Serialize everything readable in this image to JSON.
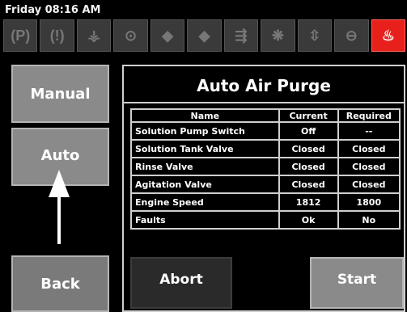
{
  "header": {
    "clock": "Friday 08:16 AM"
  },
  "icon_bar": {
    "icons": [
      {
        "name": "parking-brake-icon",
        "glyph": "(P)",
        "active": false
      },
      {
        "name": "warning-icon",
        "glyph": "(!)",
        "active": false
      },
      {
        "name": "sprayer-valve-icon",
        "glyph": "⚶",
        "active": false
      },
      {
        "name": "engine-icon",
        "glyph": "⊙",
        "active": false
      },
      {
        "name": "pump-icon",
        "glyph": "◆",
        "active": false
      },
      {
        "name": "pump-flow-icon",
        "glyph": "◆",
        "active": false
      },
      {
        "name": "valve-icon",
        "glyph": "⇶",
        "active": false
      },
      {
        "name": "agitation-icon",
        "glyph": "❋",
        "active": false
      },
      {
        "name": "tank-icon",
        "glyph": "⇳",
        "active": false
      },
      {
        "name": "fill-icon",
        "glyph": "⊖",
        "active": false
      },
      {
        "name": "alarm-icon",
        "glyph": "♨",
        "active": true
      }
    ],
    "alert_color": "#e8201c"
  },
  "side": {
    "manual_label": "Manual",
    "auto_label": "Auto",
    "back_label": "Back"
  },
  "panel": {
    "title": "Auto Air Purge",
    "columns": [
      "Name",
      "Current",
      "Required"
    ],
    "rows": [
      {
        "name": "Solution Pump Switch",
        "current": "Off",
        "required": "--"
      },
      {
        "name": "Solution Tank Valve",
        "current": "Closed",
        "required": "Closed"
      },
      {
        "name": "Rinse Valve",
        "current": "Closed",
        "required": "Closed"
      },
      {
        "name": "Agitation Valve",
        "current": "Closed",
        "required": "Closed"
      },
      {
        "name": "Engine Speed",
        "current": "1812",
        "required": "1800"
      },
      {
        "name": "Faults",
        "current": "Ok",
        "required": "No"
      }
    ],
    "abort_label": "Abort",
    "start_label": "Start"
  }
}
